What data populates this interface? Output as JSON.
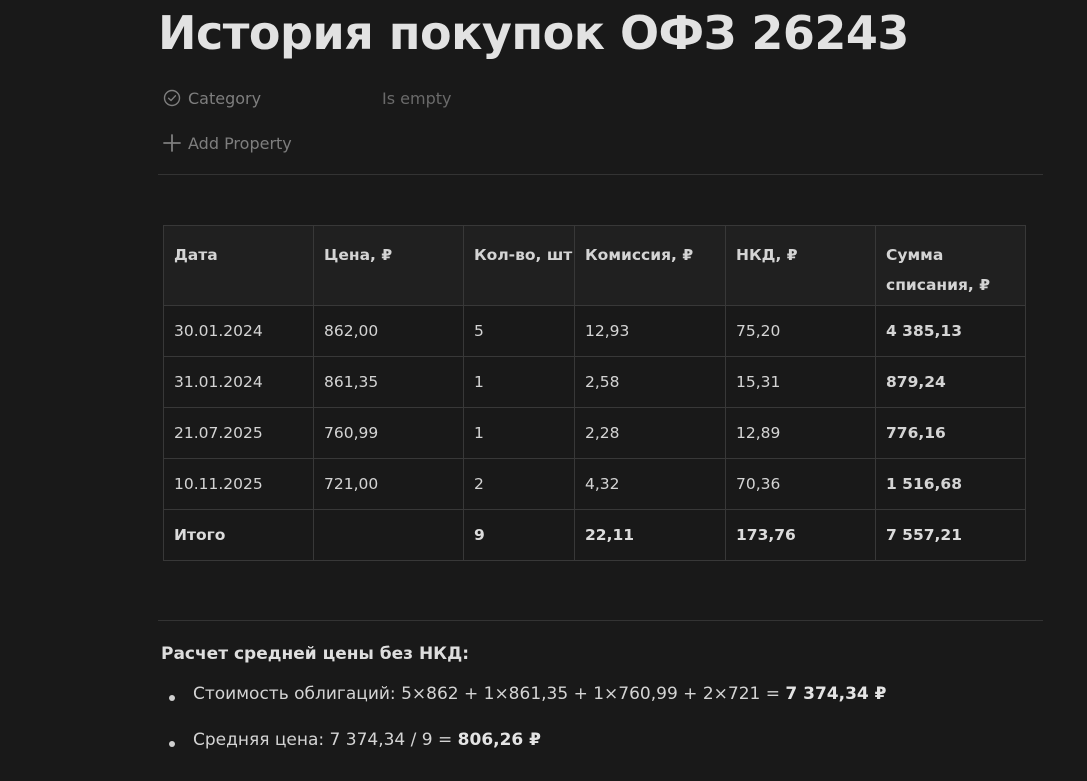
{
  "page": {
    "title": "История покупок ОФЗ 26243"
  },
  "properties": {
    "category": {
      "label": "Category",
      "value": "Is empty",
      "icon": "check-circle-icon"
    },
    "add_property": {
      "label": "Add Property",
      "icon": "plus-icon"
    }
  },
  "table": {
    "headers": [
      "Дата",
      "Цена, ₽",
      "Кол-во, шт",
      "Комиссия, ₽",
      "НКД, ₽",
      "Сумма списания, ₽"
    ],
    "rows": [
      [
        "30.01.2024",
        "862,00",
        "5",
        "12,93",
        "75,20",
        "4 385,13"
      ],
      [
        "31.01.2024",
        "861,35",
        "1",
        "2,58",
        "15,31",
        "879,24"
      ],
      [
        "21.07.2025",
        "760,99",
        "1",
        "2,28",
        "12,89",
        "776,16"
      ],
      [
        "10.11.2025",
        "721,00",
        "2",
        "4,32",
        "70,36",
        "1 516,68"
      ]
    ],
    "total": [
      "Итого",
      "",
      "9",
      "22,11",
      "173,76",
      "7 557,21"
    ]
  },
  "calculation": {
    "heading": "Расчет средней цены без НКД:",
    "items": [
      {
        "text": "Стоимость облигаций: 5×862 + 1×861,35 + 1×760,99 + 2×721 = ",
        "bold": "7 374,34 ₽"
      },
      {
        "text": "Средняя цена: 7 374,34 / 9 = ",
        "bold": "806,26 ₽"
      }
    ]
  },
  "colors": {
    "background": "#191919",
    "text": "#d4d4d4",
    "muted": "#7e7e7e",
    "header_bg": "#202020",
    "border": "#383838"
  }
}
